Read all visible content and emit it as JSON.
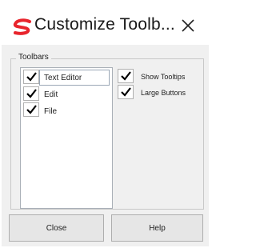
{
  "window": {
    "title": "Customize Toolb..."
  },
  "icons": {
    "app": "app-logo-icon",
    "close": "close-icon",
    "check": "checkmark-icon"
  },
  "colors": {
    "logo": "#e8242c",
    "client_bg": "#f0f0f0"
  },
  "toolbars_group": {
    "label": "Toolbars",
    "items": [
      {
        "label": "Text Editor",
        "checked": true,
        "selected": true
      },
      {
        "label": "Edit",
        "checked": true,
        "selected": false
      },
      {
        "label": "File",
        "checked": true,
        "selected": false
      }
    ]
  },
  "options": [
    {
      "label": "Show Tooltips",
      "checked": true
    },
    {
      "label": "Large Buttons",
      "checked": true
    }
  ],
  "buttons": {
    "close_label": "Close",
    "help_label": "Help"
  }
}
